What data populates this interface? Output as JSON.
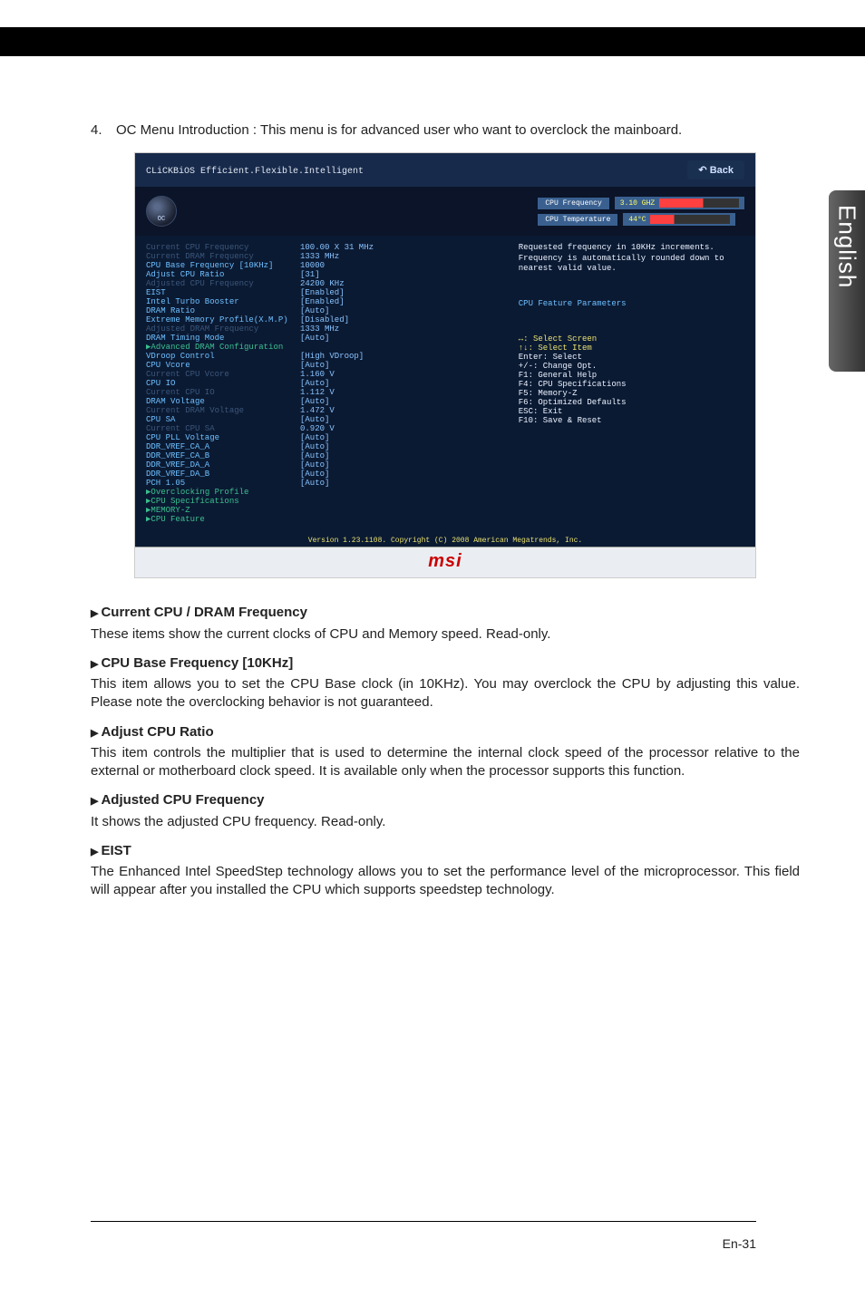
{
  "sideTab": "English",
  "intro": {
    "num": "4.",
    "text": "OC Menu Introduction : This menu is for advanced user who want to overclock the mainboard."
  },
  "ss": {
    "logoMain": "CLiCKBiOS",
    "logoSub": " Efficient.Flexible.Intelligent",
    "backLabel": "Back",
    "ocLabel": "OC",
    "stats": {
      "freqLabel": "CPU Frequency",
      "freqVal": "3.10 GHZ",
      "tempLabel": "CPU Temperature",
      "tempVal": "44°C"
    },
    "rows": [
      {
        "k": "Current CPU Frequency",
        "v": "100.00 X 31 MHz",
        "cls": "muted"
      },
      {
        "k": "Current DRAM Frequency",
        "v": "1333 MHz",
        "cls": "muted"
      },
      {
        "k": "CPU Base Frequency [10KHz]",
        "v": "10000",
        "cls": ""
      },
      {
        "k": "Adjust CPU Ratio",
        "v": "[31]",
        "cls": ""
      },
      {
        "k": "Adjusted CPU Frequency",
        "v": "24200 KHz",
        "cls": "muted"
      },
      {
        "k": "EIST",
        "v": "[Enabled]",
        "cls": ""
      },
      {
        "k": "Intel Turbo Booster",
        "v": "[Enabled]",
        "cls": ""
      },
      {
        "k": "DRAM Ratio",
        "v": "[Auto]",
        "cls": ""
      },
      {
        "k": "Extreme Memory Profile(X.M.P)",
        "v": "[Disabled]",
        "cls": ""
      },
      {
        "k": "Adjusted DRAM Frequency",
        "v": "1333 MHz",
        "cls": "muted"
      },
      {
        "k": "DRAM Timing Mode",
        "v": "[Auto]",
        "cls": ""
      },
      {
        "k": "▶Advanced DRAM Configuration",
        "v": "",
        "cls": "submenu"
      },
      {
        "k": "  VDroop Control",
        "v": "[High VDroop]",
        "cls": ""
      },
      {
        "k": "  CPU Vcore",
        "v": "[Auto]",
        "cls": ""
      },
      {
        "k": "  Current CPU Vcore",
        "v": "1.160 V",
        "cls": "muted"
      },
      {
        "k": "  CPU IO",
        "v": "[Auto]",
        "cls": ""
      },
      {
        "k": "  Current CPU IO",
        "v": "1.112 V",
        "cls": "muted"
      },
      {
        "k": "  DRAM Voltage",
        "v": "[Auto]",
        "cls": ""
      },
      {
        "k": "  Current DRAM Voltage",
        "v": "1.472 V",
        "cls": "muted"
      },
      {
        "k": "  CPU SA",
        "v": "[Auto]",
        "cls": ""
      },
      {
        "k": "  Current CPU SA",
        "v": "0.920 V",
        "cls": "muted"
      },
      {
        "k": "  CPU PLL Voltage",
        "v": "[Auto]",
        "cls": ""
      },
      {
        "k": "  DDR_VREF_CA_A",
        "v": "[Auto]",
        "cls": ""
      },
      {
        "k": "  DDR_VREF_CA_B",
        "v": "[Auto]",
        "cls": ""
      },
      {
        "k": "  DDR_VREF_DA_A",
        "v": "[Auto]",
        "cls": ""
      },
      {
        "k": "  DDR_VREF_DA_B",
        "v": "[Auto]",
        "cls": ""
      },
      {
        "k": "  PCH 1.05",
        "v": "[Auto]",
        "cls": ""
      },
      {
        "k": "▶Overclocking Profile",
        "v": "",
        "cls": "submenu"
      },
      {
        "k": "▶CPU Specifications",
        "v": "",
        "cls": "submenu"
      },
      {
        "k": "▶MEMORY-Z",
        "v": "",
        "cls": "submenu"
      },
      {
        "k": "▶CPU Feature",
        "v": "",
        "cls": "submenu"
      }
    ],
    "help": "Requested frequency in 10KHz increments. Frequency is automatically rounded down to nearest valid value.",
    "help2": "CPU Feature Parameters",
    "hints": [
      {
        "t": "↔: Select Screen",
        "c": "yellow"
      },
      {
        "t": "↑↓: Select Item",
        "c": "yellow"
      },
      {
        "t": "Enter: Select",
        "c": ""
      },
      {
        "t": "+/-: Change Opt.",
        "c": ""
      },
      {
        "t": "F1: General Help",
        "c": ""
      },
      {
        "t": "F4: CPU Specifications",
        "c": ""
      },
      {
        "t": "F5: Memory-Z",
        "c": ""
      },
      {
        "t": "F6: Optimized Defaults",
        "c": ""
      },
      {
        "t": "ESC: Exit",
        "c": ""
      },
      {
        "t": "F10: Save & Reset",
        "c": ""
      }
    ],
    "version": "Version 1.23.1108. Copyright (C) 2008 American Megatrends, Inc.",
    "msi": "msi"
  },
  "sections": [
    {
      "h": "Current CPU / DRAM Frequency",
      "p": "These items show the current clocks of CPU and Memory speed. Read-only."
    },
    {
      "h": "CPU Base Frequency [10KHz]",
      "p": "This item allows you to set the CPU Base clock (in 10KHz). You may overclock the CPU by adjusting this value. Please note the overclocking behavior is not guaranteed."
    },
    {
      "h": "Adjust CPU Ratio",
      "p": "This item controls the multiplier that is used to determine the internal clock speed of the processor relative to the external or motherboard clock speed. It is available only when the processor supports this function."
    },
    {
      "h": "Adjusted CPU Frequency",
      "p": "It shows the adjusted CPU frequency. Read-only."
    },
    {
      "h": "EIST",
      "p": "The Enhanced Intel SpeedStep technology allows you to set the performance level of the microprocessor. This field will appear after you installed the CPU which supports speedstep technology."
    }
  ],
  "pageNum": "En-31"
}
